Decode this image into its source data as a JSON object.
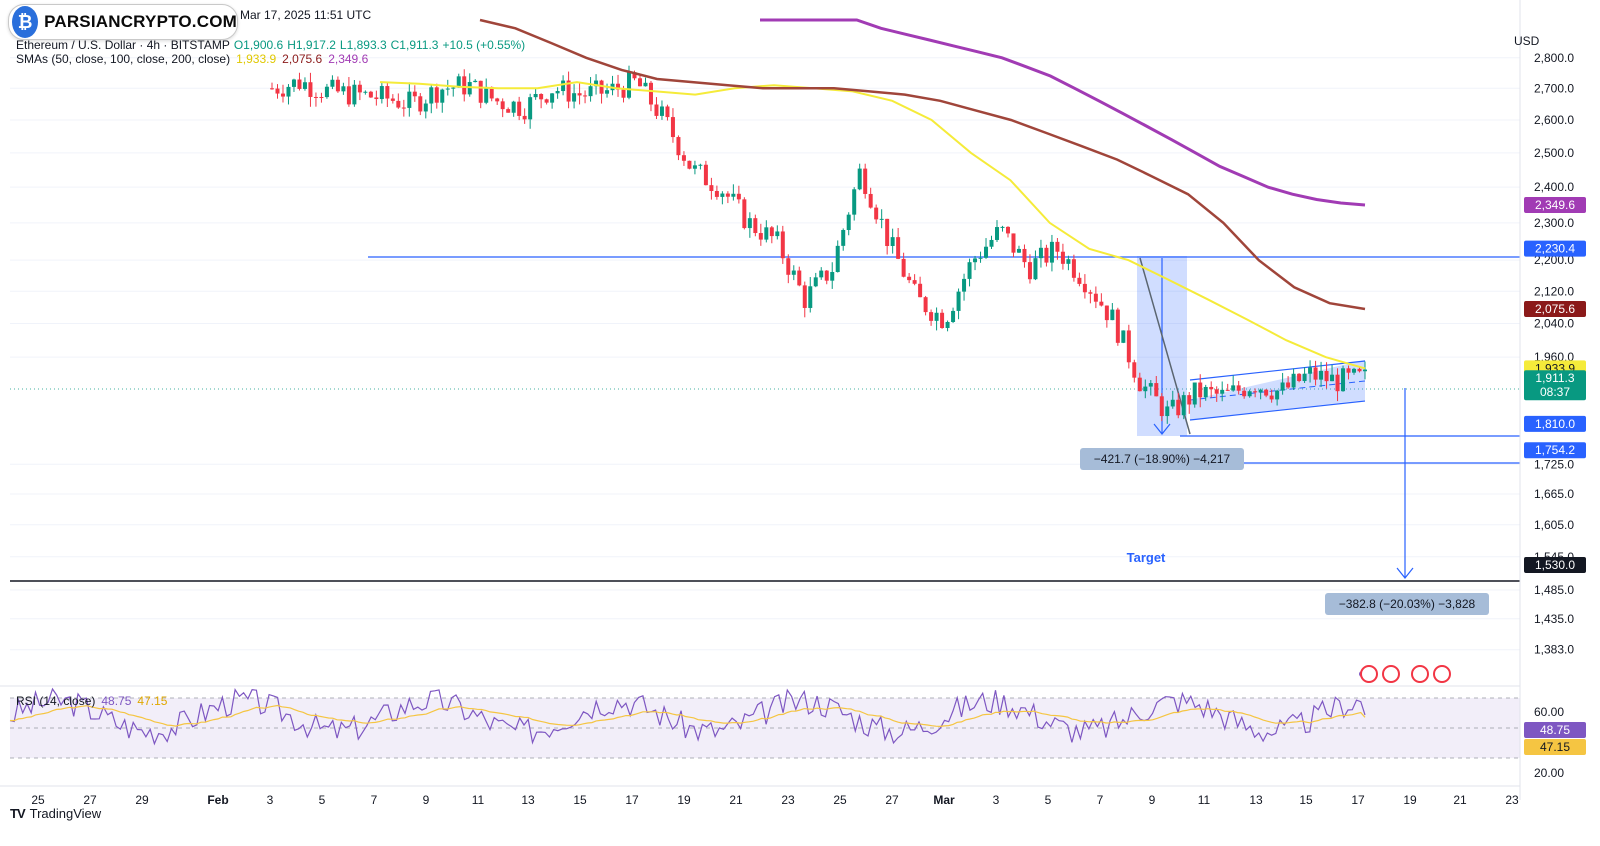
{
  "header": {
    "date": "Mar 17, 2025 11:51 UTC",
    "symbol_line": "Ethereum / U.S. Dollar · 4h · BITSTAMP",
    "open": "O1,900.6",
    "high": "H1,917.2",
    "low": "L1,893.3",
    "close": "C1,911.3",
    "change": "+10.5 (+0.55%)",
    "sma_label": "SMAs (50, close, 100, close, 200, close)",
    "sma_values": [
      "1,933.9",
      "2,075.6",
      "2,349.6"
    ]
  },
  "logo": {
    "text": "PARSIANCRYPTO.COM"
  },
  "currency": "USD",
  "colors": {
    "up": "#089981",
    "down": "#f23645",
    "sma50": "#f5eb3a",
    "sma100": "#a0453a",
    "sma200": "#a13bb4",
    "level_line": "#2962ff",
    "support_line": "#131722",
    "rsi_line": "#7e57c2",
    "rsi_ma": "#f5c542"
  },
  "annotations": {
    "drop_measure": "−421.7 (−18.90%) −4,217",
    "target_measure": "−382.8 (−20.03%) −3,828",
    "target_label": "Target"
  },
  "rsi_label": {
    "name": "RSI (14, close)",
    "value": "48.75",
    "ma": "47.15"
  },
  "branding": "TradingView",
  "chart_data": {
    "type": "line",
    "title": "Ethereum / U.S. Dollar · 4h · BITSTAMP",
    "price_axis": {
      "ticks": [
        "2,800.0",
        "2,700.0",
        "2,600.0",
        "2,500.0",
        "2,400.0",
        "2,300.0",
        "2,200.0",
        "2,120.0",
        "2,040.0",
        "1,960.0",
        "1,725.0",
        "1,665.0",
        "1,605.0",
        "1,545.0",
        "1,485.0",
        "1,435.0",
        "1,383.0"
      ],
      "ylim": [
        1350,
        2860
      ],
      "scale": "log"
    },
    "price_labels": [
      {
        "text": "2,349.6",
        "value": 2349.6,
        "color": "#a13bb4"
      },
      {
        "text": "2,230.4",
        "value": 2230.4,
        "color": "#2962ff"
      },
      {
        "text": "2,075.6",
        "value": 2075.6,
        "color": "#8b1a1a"
      },
      {
        "text": "1,933.9",
        "value": 1933.9,
        "color": "#f5eb3a"
      },
      {
        "text": "1,911.3",
        "value": 1911.3,
        "color": "#089981",
        "sub": "08:37"
      },
      {
        "text": "1,810.0",
        "value": 1810.0,
        "color": "#2962ff"
      },
      {
        "text": "1,754.2",
        "value": 1754.2,
        "color": "#2962ff"
      },
      {
        "text": "1,530.0",
        "value": 1530.0,
        "color": "#131722"
      }
    ],
    "x_ticks": [
      "25",
      "27",
      "29",
      "Feb",
      "3",
      "5",
      "7",
      "9",
      "11",
      "13",
      "15",
      "17",
      "19",
      "21",
      "23",
      "25",
      "27",
      "Mar",
      "3",
      "5",
      "7",
      "9",
      "11",
      "13",
      "15",
      "17",
      "19",
      "21",
      "23"
    ],
    "horizontal_levels": [
      2230.4,
      1810.0,
      1754.2,
      1530.0
    ],
    "series": [
      {
        "name": "SMA 50",
        "values": [
          2720,
          2715,
          2705,
          2700,
          2700,
          2720,
          2700,
          2690,
          2680,
          2700,
          2710,
          2700,
          2690,
          2660,
          2600,
          2500,
          2420,
          2300,
          2230,
          2200,
          2150,
          2100,
          2050,
          2000,
          1960,
          1933.9
        ]
      },
      {
        "name": "SMA 100",
        "values": [
          2950,
          2900,
          2850,
          2800,
          2760,
          2730,
          2720,
          2710,
          2700,
          2700,
          2700,
          2690,
          2680,
          2660,
          2630,
          2600,
          2560,
          2520,
          2480,
          2430,
          2380,
          2300,
          2200,
          2130,
          2090,
          2075.6
        ]
      },
      {
        "name": "SMA 200",
        "values": [
          3100,
          3050,
          3000,
          2960,
          2930,
          2900,
          2880,
          2860,
          2840,
          2820,
          2800,
          2770,
          2740,
          2700,
          2660,
          2620,
          2580,
          2540,
          2500,
          2460,
          2430,
          2400,
          2380,
          2365,
          2355,
          2349.6
        ]
      }
    ],
    "close_path": [
      2700,
      2720,
      2690,
      2680,
      2670,
      2650,
      2700,
      2710,
      2660,
      2640,
      2700,
      2680,
      2690,
      2720,
      2600,
      2450,
      2400,
      2300,
      2250,
      2100,
      2180,
      2450,
      2250,
      2100,
      2050,
      2200,
      2280,
      2180,
      2230,
      2150,
      2050,
      1900,
      1830,
      1880,
      1870,
      1900,
      1880,
      1920,
      1905,
      1911.3
    ],
    "rsi": {
      "axis": [
        "60.00",
        "20.00"
      ],
      "last": 48.75,
      "ma": 47.15
    }
  }
}
